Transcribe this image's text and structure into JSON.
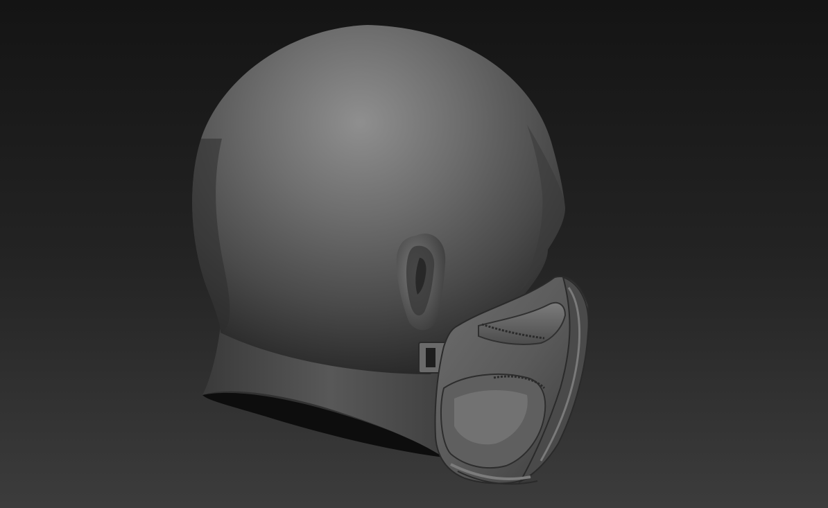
{
  "scene": {
    "subject": "sculpted-head-with-mask",
    "background_top": "#141414",
    "background_bottom": "#3c3c3c",
    "material_light": "#8a8a8a",
    "material_mid": "#555555",
    "material_dark": "#262626",
    "material_shadow": "#0b0b0b"
  }
}
